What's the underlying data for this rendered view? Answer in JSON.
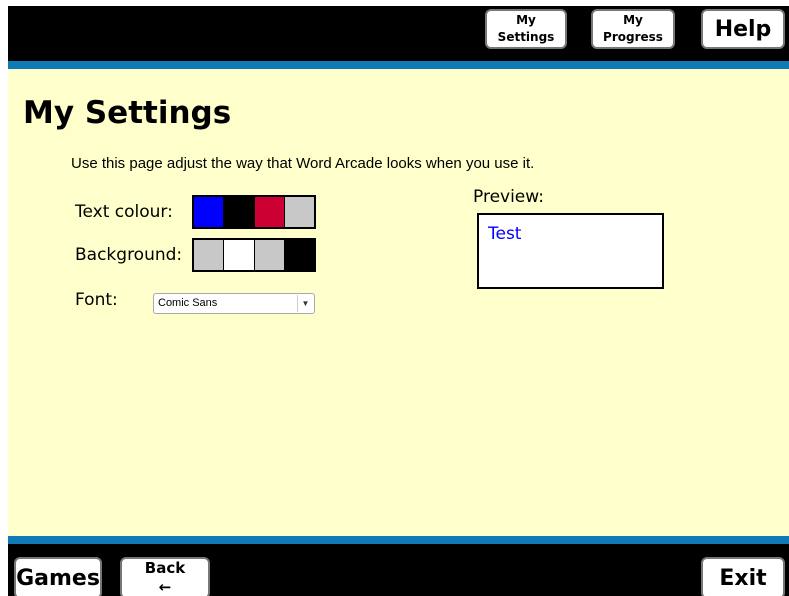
{
  "header": {
    "my_settings": [
      "My",
      "Settings"
    ],
    "my_progress": [
      "My",
      "Progress"
    ],
    "help": "Help"
  },
  "page": {
    "title": "My Settings",
    "intro": "Use this page adjust the way that Word Arcade looks when you use it."
  },
  "settings": {
    "text_colour": {
      "label": "Text colour:",
      "swatches": [
        "#0000ff",
        "#000000",
        "#cc0033",
        "#c8c8c8"
      ]
    },
    "background": {
      "label": "Background:",
      "swatches": [
        "#c8c8c8",
        "#ffffff",
        "#c8c8c8",
        "#000000"
      ]
    },
    "font": {
      "label": "Font:",
      "value": "Comic Sans"
    }
  },
  "preview": {
    "label": "Preview:",
    "text": "Test",
    "text_color": "#0000ff",
    "bg_color": "#ffffff"
  },
  "footer": {
    "games": "Games",
    "back": "Back",
    "back_icon": "←",
    "exit": "Exit"
  },
  "colors": {
    "bar": "#000000",
    "accent": "#0f7ab5",
    "content_bg": "#ffffcc"
  }
}
